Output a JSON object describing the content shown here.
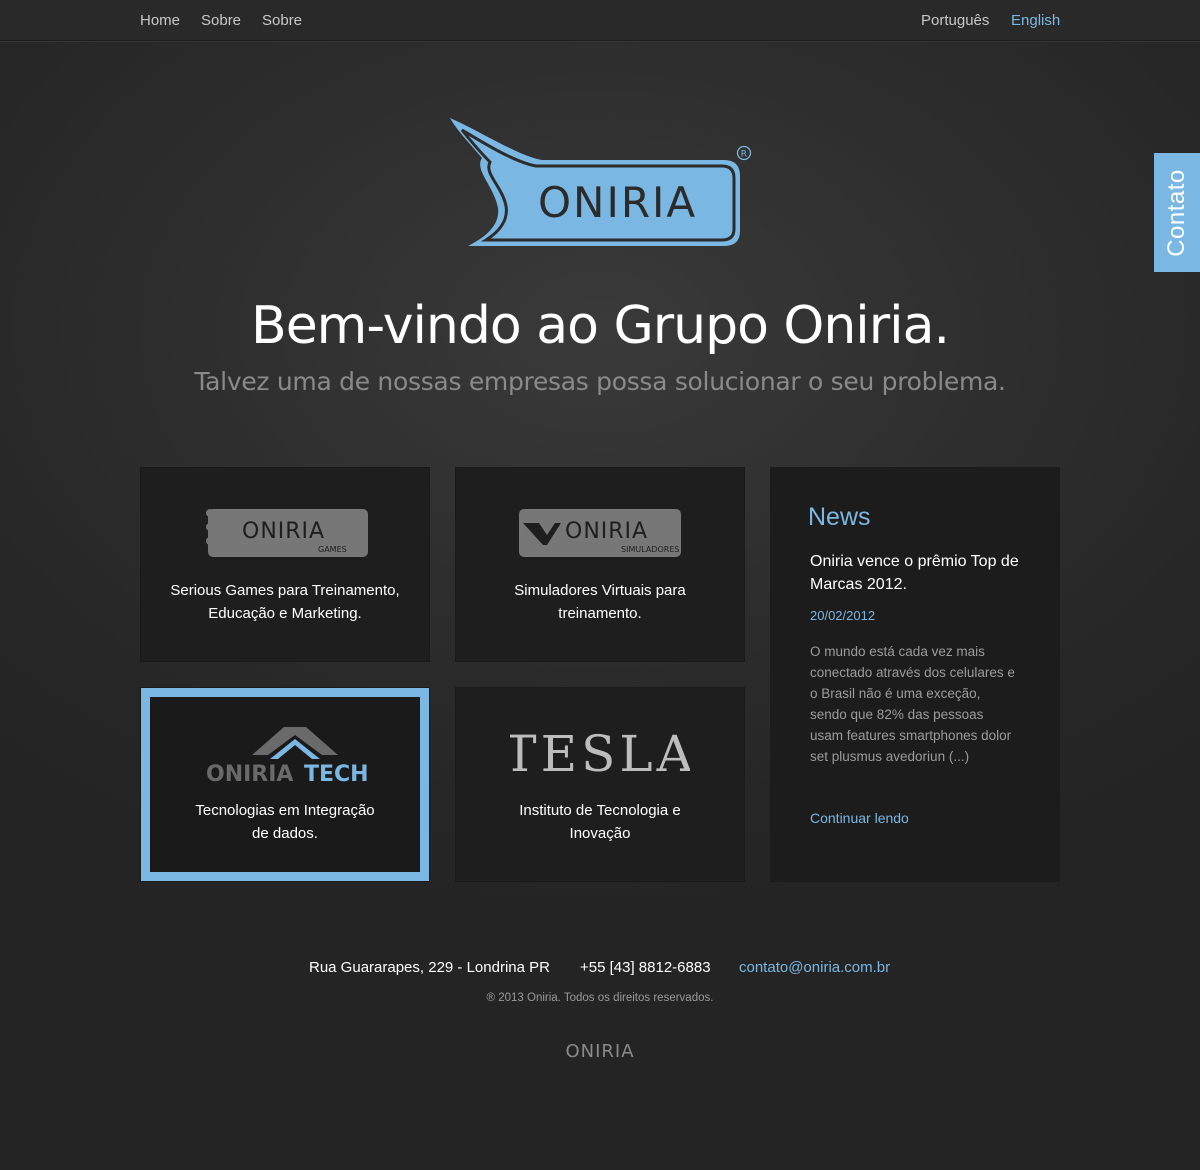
{
  "nav": {
    "home": "Home",
    "sobre_1": "Sobre",
    "sobre_2": "Sobre",
    "lang_pt": "Português",
    "lang_en": "English"
  },
  "contato_tab": "Contato",
  "hero": {
    "logo_text": "ONIRIA",
    "title": "Bem-vindo ao Grupo Oniria.",
    "subtitle": "Talvez uma de nossas empresas possa solucionar o seu problema."
  },
  "companies": [
    {
      "logo_text": "ONIRIA",
      "logo_sub": "GAMES",
      "description_1": "Serious Games para Treinamento,",
      "description_2": "Educação e Marketing."
    },
    {
      "logo_text": "ONIRIA",
      "logo_sub": "SIMULADORES",
      "description_1": "Simuladores Virtuais para",
      "description_2": "treinamento."
    },
    {
      "logo_text_a": "ONIRIA",
      "logo_text_b": "TECH",
      "description_1": "Tecnologias em Integração",
      "description_2": "de dados."
    },
    {
      "logo_text": "TESLA",
      "description_1": "Instituto de Tecnologia e",
      "description_2": "Inovação"
    }
  ],
  "news": {
    "title": "News",
    "headline": "Oniria vence o prêmio Top de Marcas 2012.",
    "date": "20/02/2012",
    "body": "O mundo está cada vez mais conectado através dos celulares e o Brasil não é uma exceção, sendo que 82% das pessoas usam features smartphones dolor set plusmus avedoriun (...)",
    "more": "Continuar lendo"
  },
  "footer": {
    "address": "Rua Guararapes, 229 - Londrina PR",
    "phone": "+55 [43] 8812-6883",
    "email": "contato@oniria.com.br",
    "copyright": "® 2013 Oniria. Todos os direitos reservados.",
    "logo_text": "ONIRIA"
  },
  "colors": {
    "accent": "#7ab8e3",
    "background": "#2e2e2e",
    "card": "#1e1e1e"
  }
}
